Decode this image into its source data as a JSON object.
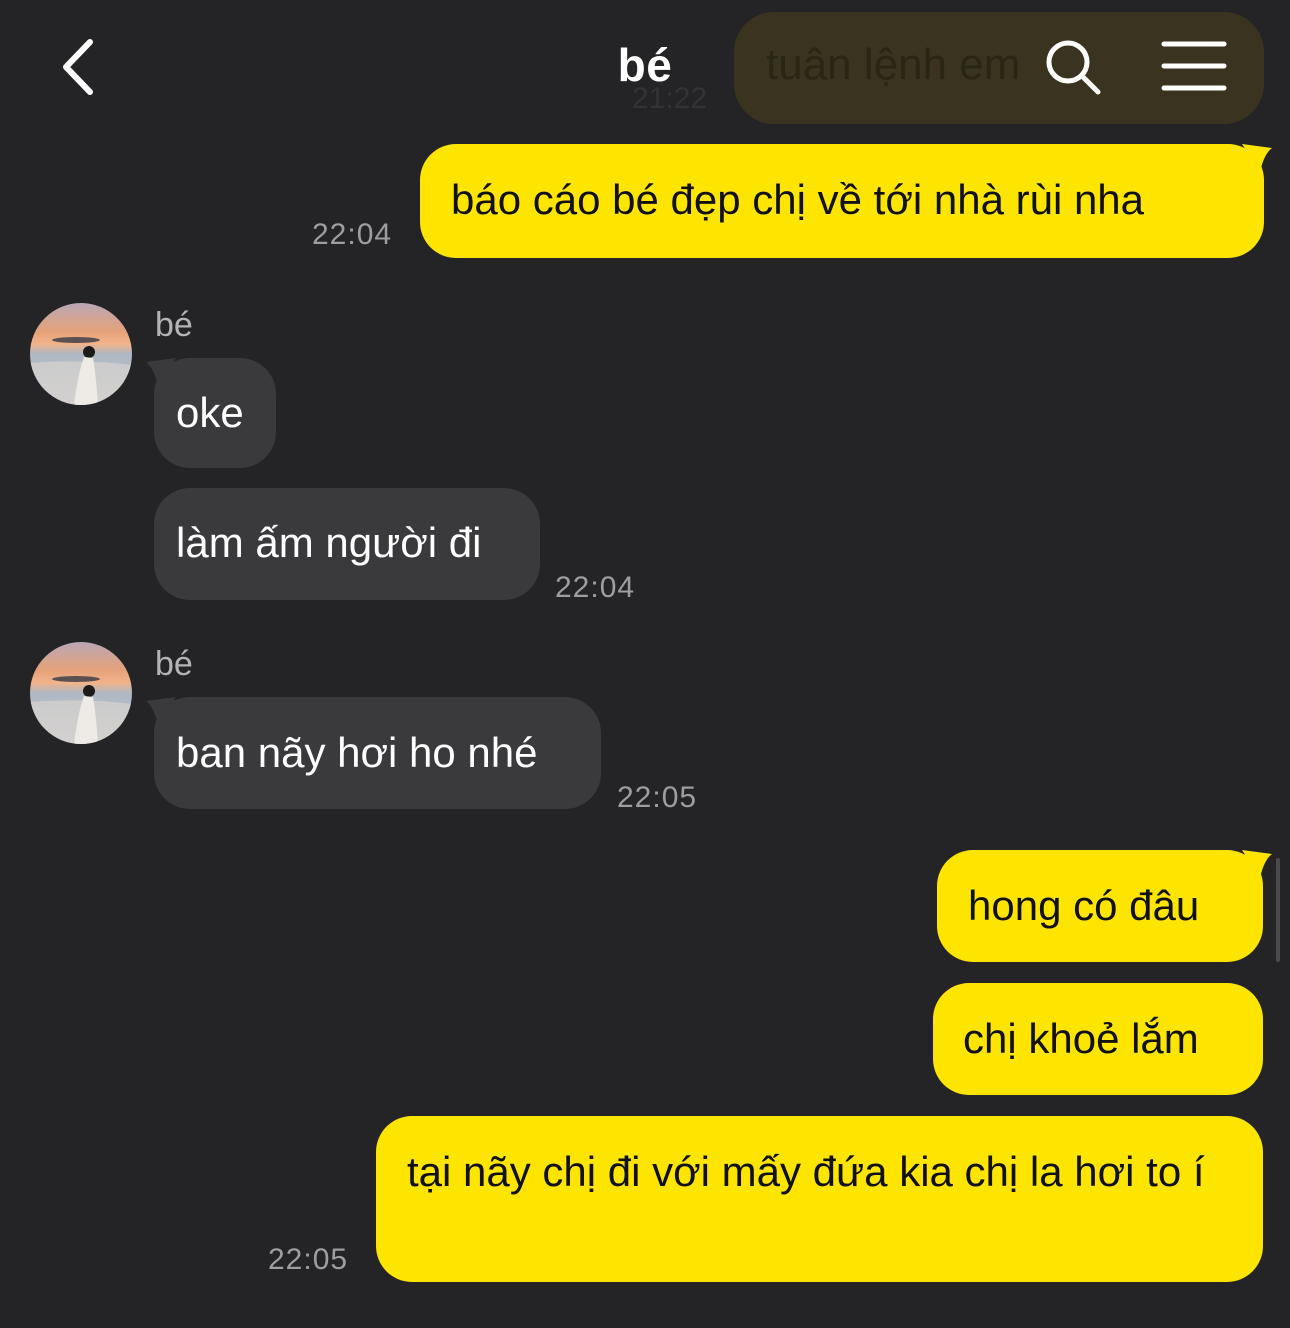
{
  "header": {
    "title": "bé",
    "back_icon": "chevron-left-icon",
    "search_icon": "search-icon",
    "menu_icon": "hamburger-menu-icon"
  },
  "previous_message": {
    "text": "tuân lệnh em",
    "time": "21:22"
  },
  "messages": [
    {
      "from": "me",
      "text": "báo cáo bé đẹp chị về tới nhà rùi nha",
      "time": "22:04"
    },
    {
      "from": "them",
      "sender": "bé",
      "text": "oke"
    },
    {
      "from": "them",
      "text": "làm ấm người đi",
      "time": "22:04"
    },
    {
      "from": "them",
      "sender": "bé",
      "text": "ban nãy hơi ho nhé",
      "time": "22:05"
    },
    {
      "from": "me",
      "text": "hong có đâu"
    },
    {
      "from": "me",
      "text": "chị khoẻ lắm"
    },
    {
      "from": "me",
      "text": "tại nãy chị đi với mấy đứa kia chị la hơi to í",
      "time": "22:05"
    }
  ],
  "colors": {
    "background": "#242426",
    "my_bubble": "#fee500",
    "their_bubble": "#3a3a3d",
    "timestamp": "#9d9da2"
  }
}
